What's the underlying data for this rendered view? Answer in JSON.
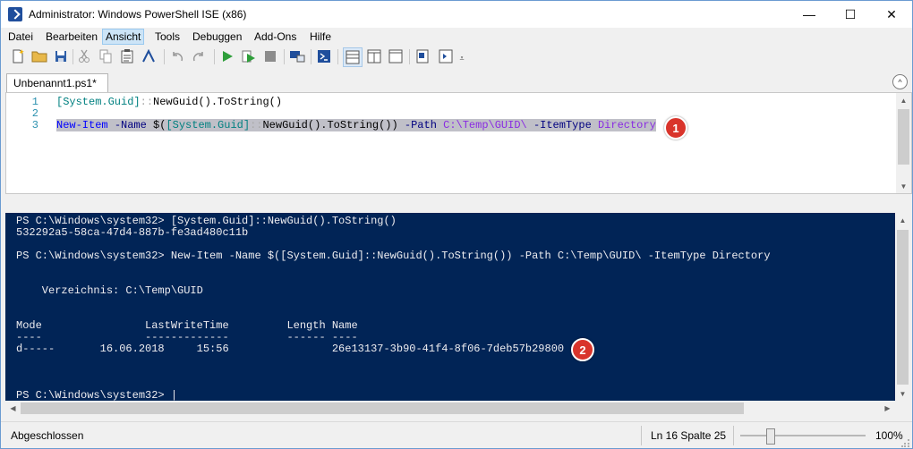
{
  "window": {
    "title": "Administrator: Windows PowerShell ISE (x86)",
    "minimize": "—",
    "maximize": "☐",
    "close": "✕"
  },
  "menu": {
    "items": [
      "Datei",
      "Bearbeiten",
      "Ansicht",
      "Tools",
      "Debuggen",
      "Add-Ons",
      "Hilfe"
    ],
    "active": "Ansicht"
  },
  "toolbar": {
    "icons": [
      "new-file-icon",
      "open-folder-icon",
      "save-icon",
      "cut-icon",
      "copy-icon",
      "paste-icon",
      "clear-console-icon",
      "undo-icon",
      "redo-icon",
      "run-script-icon",
      "run-selection-icon",
      "stop-icon",
      "new-remote-tab-icon",
      "start-powershell-icon",
      "layout-script-top-icon",
      "layout-script-right-icon",
      "layout-script-maximized-icon",
      "show-command-window-icon",
      "show-command-addon-icon",
      "toolbar-overflow-icon"
    ]
  },
  "tab": {
    "label": "Unbenannt1.ps1*",
    "collapse_glyph": "^"
  },
  "editor": {
    "line_numbers": [
      "1",
      "2",
      "3"
    ],
    "line1": {
      "type": "[System.Guid]",
      "op": "::",
      "rest": "NewGuid().ToString()"
    },
    "line3": {
      "cmd": "New-Item",
      "par1": "-Name",
      "sub_open": "$(",
      "type": "[System.Guid]",
      "op": "::",
      "member": "NewGuid().ToString())",
      "par2": "-Path",
      "path": "C:\\Temp\\GUID\\",
      "par3": "-ItemType",
      "val": "Directory"
    }
  },
  "console": {
    "lines": [
      "PS C:\\Windows\\system32> [System.Guid]::NewGuid().ToString()",
      "532292a5-58ca-47d4-887b-fe3ad480c11b",
      "",
      "PS C:\\Windows\\system32> New-Item -Name $([System.Guid]::NewGuid().ToString()) -Path C:\\Temp\\GUID\\ -ItemType Directory",
      "",
      "",
      "    Verzeichnis: C:\\Temp\\GUID",
      "",
      "",
      "Mode                LastWriteTime         Length Name",
      "----                -------------         ------ ----",
      "d-----       16.06.2018     15:56                26e13137-3b90-41f4-8f06-7deb57b29800",
      "",
      "",
      "PS C:\\Windows\\system32> |"
    ]
  },
  "callouts": {
    "one": "1",
    "two": "2"
  },
  "status": {
    "state": "Abgeschlossen",
    "position": "Ln 16  Spalte 25",
    "zoom": "100%",
    "zoom_level": 0.2
  },
  "colors": {
    "console_bg": "#012456",
    "badge": "#d9342b",
    "selection": "#c0c0c8"
  }
}
